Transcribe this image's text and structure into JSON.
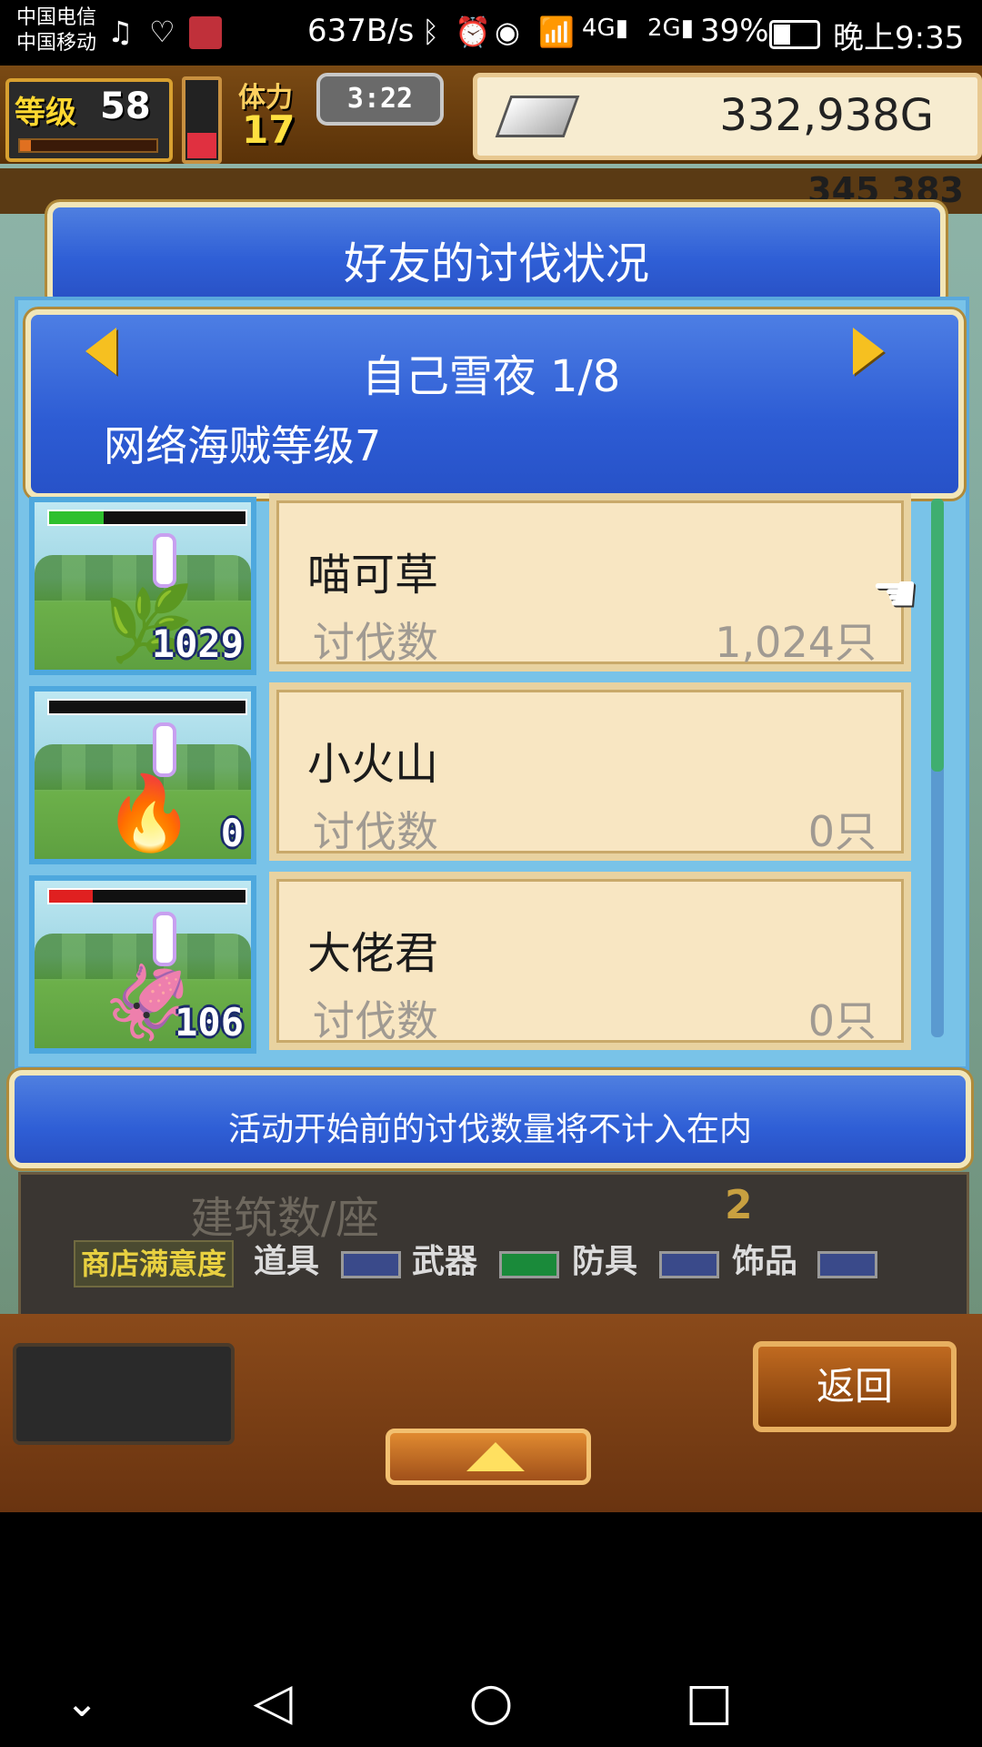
{
  "status_bar": {
    "carrier1": "中国电信",
    "carrier2": "中国移动",
    "net_speed": "637B/s",
    "battery_percent": "39%",
    "time": "晚上9:35"
  },
  "top_bar": {
    "level_label": "等级",
    "level": "58",
    "stamina_label": "体力",
    "stamina": "17",
    "timer": "3:22",
    "gold": "332,938G"
  },
  "background_counts": "345  383",
  "dialog": {
    "title": "好友的讨伐状况",
    "friend_name": "自己雪夜 1/8",
    "rank": "网络海贼等级7",
    "rows": [
      {
        "name": "喵可草",
        "label": "讨伐数",
        "value": "1,024只",
        "thumb_count": "1029",
        "hp_color": "#2ec02e",
        "hp_fraction": 0.28,
        "monster": "🌿"
      },
      {
        "name": "小火山",
        "label": "讨伐数",
        "value": "0只",
        "thumb_count": "0",
        "hp_color": "#2ec02e",
        "hp_fraction": 0.0,
        "monster": "🔥"
      },
      {
        "name": "大佬君",
        "label": "讨伐数",
        "value": "0只",
        "thumb_count": "106",
        "hp_color": "#e02020",
        "hp_fraction": 0.22,
        "monster": "🦑"
      }
    ],
    "notice": "活动开始前的讨伐数量将不计入在内"
  },
  "stats": {
    "building_label": "建筑数/座",
    "building_value": "2",
    "satisfaction_label": "商店满意度",
    "categories": [
      {
        "label": "道具",
        "gauge_color": "#3a4a8a"
      },
      {
        "label": "武器",
        "gauge_color": "#1a8a3a"
      },
      {
        "label": "防具",
        "gauge_color": "#3a4a8a"
      },
      {
        "label": "饰品",
        "gauge_color": "#3a4a8a"
      }
    ]
  },
  "buttons": {
    "back": "返回"
  }
}
